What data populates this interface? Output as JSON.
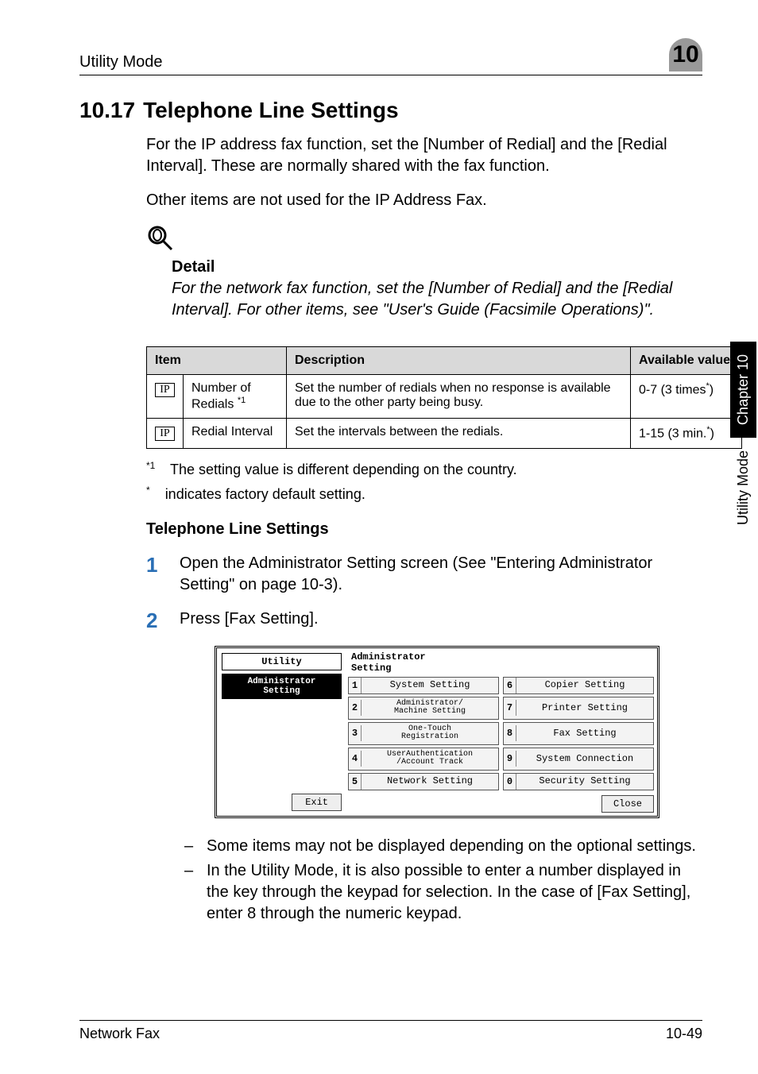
{
  "running_head": {
    "title": "Utility Mode",
    "chapter_badge": "10"
  },
  "h1": {
    "number": "10.17",
    "text": "Telephone Line Settings"
  },
  "intro_p1": "For the IP address fax function, set the [Number of Redial] and the [Redial Interval]. These are normally shared with the fax function.",
  "intro_p2": "Other items are not used for the IP Address Fax.",
  "detail": {
    "heading": "Detail",
    "text": "For the network fax function, set the [Number of Redial] and the [Redial Interval]. For other items, see \"User's Guide (Facsimile Operations)\"."
  },
  "table": {
    "headers": [
      "Item",
      "Description",
      "Available value"
    ],
    "rows": [
      {
        "badge": "IP",
        "item": "Number of Redials",
        "item_sup": "*1",
        "desc": "Set the number of redials when no response is available due to the other party being busy.",
        "value_prefix": "0-7 (3 times",
        "value_sup": "*",
        "value_suffix": ")"
      },
      {
        "badge": "IP",
        "item": "Redial Interval",
        "item_sup": "",
        "desc": "Set the intervals between the redials.",
        "value_prefix": "1-15 (3 min.",
        "value_sup": "*",
        "value_suffix": ")"
      }
    ]
  },
  "footnote1": {
    "mark": "*1",
    "text": "The setting value is different depending on the country."
  },
  "footnote2": {
    "mark": "*",
    "text": "indicates factory default setting."
  },
  "sub_heading": "Telephone Line Settings",
  "steps": [
    {
      "n": "1",
      "t": "Open the Administrator Setting screen (See \"Entering Administrator Setting\" on page 10-3)."
    },
    {
      "n": "2",
      "t": "Press [Fax Setting]."
    }
  ],
  "lcd": {
    "header": "Administrator\nSetting",
    "left_tab1": "Utility",
    "left_tab2": "Administrator\nSetting",
    "exit": "Exit",
    "close": "Close",
    "buttons": [
      {
        "no": "1",
        "label": "System Setting"
      },
      {
        "no": "6",
        "label": "Copier Setting"
      },
      {
        "no": "2",
        "label": "Administrator/\nMachine Setting"
      },
      {
        "no": "7",
        "label": "Printer Setting"
      },
      {
        "no": "3",
        "label": "One-Touch\nRegistration"
      },
      {
        "no": "8",
        "label": "Fax Setting"
      },
      {
        "no": "4",
        "label": "UserAuthentication\n/Account Track"
      },
      {
        "no": "9",
        "label": "System Connection"
      },
      {
        "no": "5",
        "label": "Network Setting"
      },
      {
        "no": "0",
        "label": "Security Setting"
      }
    ]
  },
  "dash_items": [
    "Some items may not be displayed depending on the optional settings.",
    "In the Utility Mode, it is also possible to enter a number displayed in the key through the keypad for selection. In the case of [Fax Setting], enter 8 through the numeric keypad."
  ],
  "footer": {
    "left": "Network Fax",
    "right": "10-49"
  },
  "side": {
    "black": "Chapter 10",
    "plain": "Utility Mode"
  }
}
